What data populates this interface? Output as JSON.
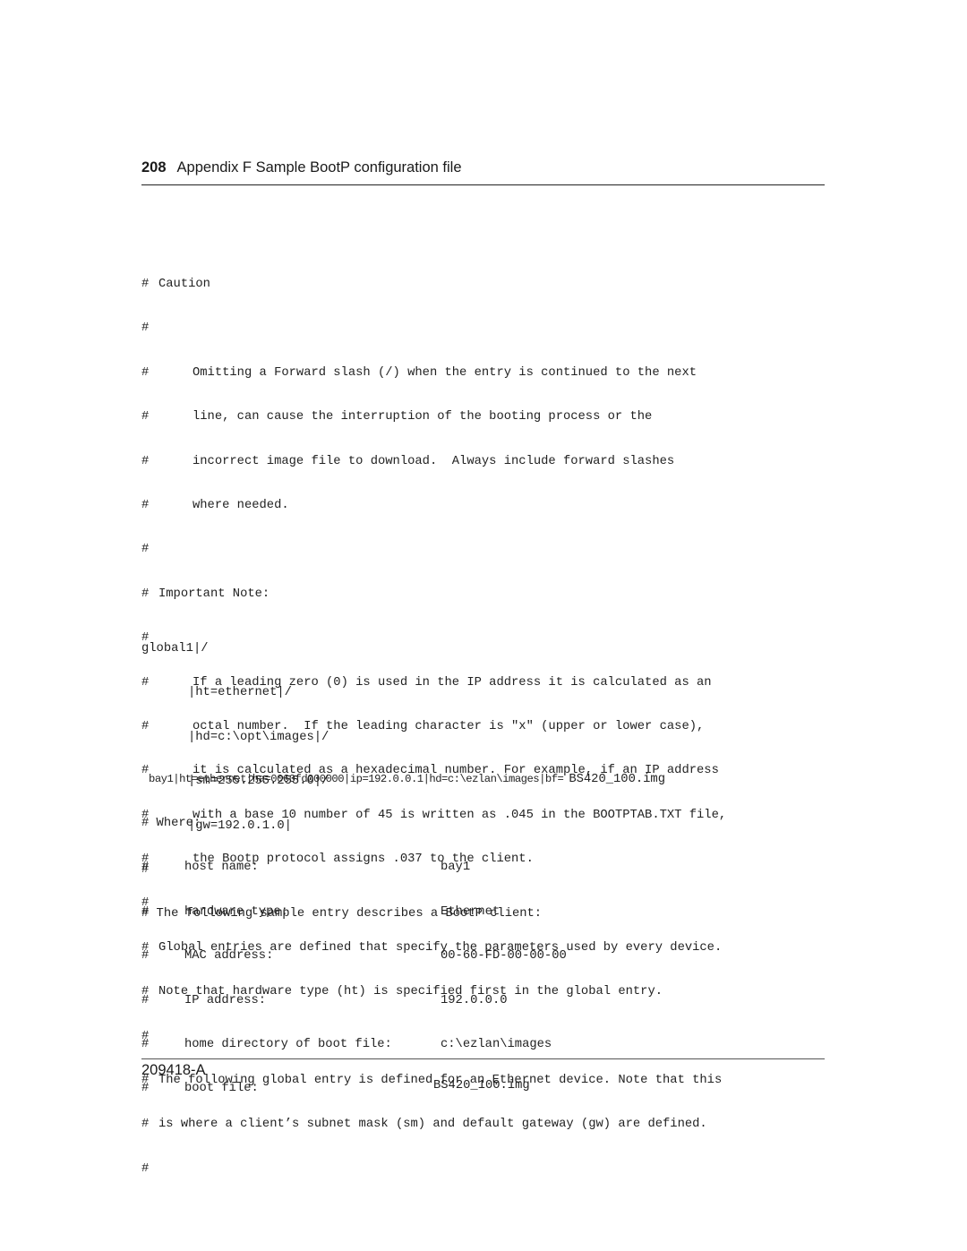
{
  "header": {
    "page_number": "208",
    "title": "Appendix F  Sample BootP configuration file"
  },
  "code_block_1": [
    {
      "hash": "#",
      "text": "Caution",
      "indent": false
    },
    {
      "hash": "#",
      "text": "",
      "indent": false
    },
    {
      "hash": "#",
      "text": "Omitting a Forward slash (/) when the entry is continued to the next",
      "indent": true
    },
    {
      "hash": "#",
      "text": "line, can cause the interruption of the booting process or the",
      "indent": true
    },
    {
      "hash": "#",
      "text": "incorrect image file to download.  Always include forward slashes",
      "indent": true
    },
    {
      "hash": "#",
      "text": "where needed.",
      "indent": true
    },
    {
      "hash": "#",
      "text": "",
      "indent": false
    },
    {
      "hash": "#",
      "text": "Important Note:",
      "indent": false
    },
    {
      "hash": "#",
      "text": "",
      "indent": false
    },
    {
      "hash": "#",
      "text": "If a leading zero (0) is used in the IP address it is calculated as an",
      "indent": true
    },
    {
      "hash": "#",
      "text": "octal number.  If the leading character is \"x\" (upper or lower case),",
      "indent": true
    },
    {
      "hash": "#",
      "text": "it is calculated as a hexadecimal number. For example, if an IP address",
      "indent": true
    },
    {
      "hash": "#",
      "text": "with a base 10 number of 45 is written as .045 in the BOOTPTAB.TXT file,",
      "indent": true
    },
    {
      "hash": "#",
      "text": "the Bootp protocol assigns .037 to the client.",
      "indent": true
    },
    {
      "hash": "#",
      "text": "",
      "indent": false
    },
    {
      "hash": "#",
      "text": "Global entries are defined that specify the parameters used by every device.",
      "indent": false
    },
    {
      "hash": "#",
      "text": "Note that hardware type (ht) is specified first in the global entry.",
      "indent": false
    },
    {
      "hash": "#",
      "text": "",
      "indent": false
    },
    {
      "hash": "#",
      "text": "The following global entry is defined for an Ethernet device. Note that this",
      "indent": false
    },
    {
      "hash": "#",
      "text": "is where a client’s subnet mask (sm) and default gateway (gw) are defined.",
      "indent": false
    },
    {
      "hash": "#",
      "text": "",
      "indent": false
    }
  ],
  "global_entry": {
    "head": "global1|/",
    "lines": [
      "|ht=ethernet|/",
      "|hd=c:\\opt\\images|/",
      "|sm=255.255.255.0|/",
      "|gw=192.0.1.0|"
    ],
    "after": [
      "#",
      "# The following sample entry describes a BootP client:"
    ]
  },
  "client_entry": {
    "prefix": "bay1|ht=ethernet|ha=0060fd000000|ip=192.0.0.1|hd=c:\\ezlan\\images|bf=",
    "boot_file": "BS420_100.img"
  },
  "where": {
    "title": "# Where:",
    "rows": [
      {
        "hash": "#",
        "key": "host name:",
        "value": "bay1"
      },
      {
        "hash": "#",
        "key": "hardware type:",
        "value": "Ethernet"
      },
      {
        "hash": "#",
        "key": "MAC address:",
        "value": "00-60-FD-00-00-00"
      },
      {
        "hash": "#",
        "key": "IP address:",
        "value": "192.0.0.0"
      },
      {
        "hash": "#",
        "key": "home directory of boot file:",
        "value": "c:\\ezlan\\images"
      },
      {
        "hash": "#",
        "key": "boot file:",
        "value": "BS420_100.img"
      }
    ]
  },
  "footer": {
    "doc_number": "209418-A"
  }
}
